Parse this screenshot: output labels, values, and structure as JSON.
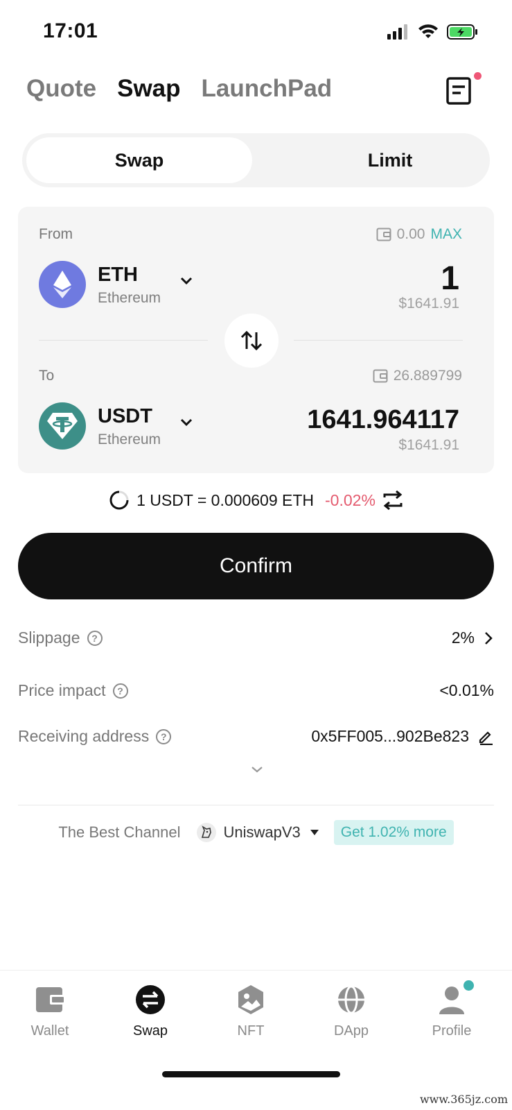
{
  "status_bar": {
    "time": "17:01"
  },
  "top_tabs": [
    {
      "label": "Quote",
      "active": false
    },
    {
      "label": "Swap",
      "active": true
    },
    {
      "label": "LaunchPad",
      "active": false
    }
  ],
  "segment": {
    "swap_label": "Swap",
    "limit_label": "Limit",
    "active": "Swap"
  },
  "from": {
    "label": "From",
    "balance": "0.00",
    "max_label": "MAX",
    "token_symbol": "ETH",
    "token_chain": "Ethereum",
    "amount": "1",
    "usd_value": "$1641.91"
  },
  "to": {
    "label": "To",
    "balance": "26.889799",
    "token_symbol": "USDT",
    "token_chain": "Ethereum",
    "amount": "1641.964117",
    "usd_value": "$1641.91"
  },
  "rate": {
    "text": "1 USDT = 0.000609 ETH",
    "change": "-0.02%"
  },
  "confirm_label": "Confirm",
  "details": {
    "slippage_label": "Slippage",
    "slippage_value": "2%",
    "price_impact_label": "Price impact",
    "price_impact_value": "<0.01%",
    "receiving_address_label": "Receiving address",
    "receiving_address_value": "0x5FF005...902Be823"
  },
  "channel": {
    "label": "The Best Channel",
    "dex": "UniswapV3",
    "promo": "Get 1.02% more"
  },
  "bottom_nav": [
    {
      "label": "Wallet",
      "icon": "wallet-icon",
      "active": false
    },
    {
      "label": "Swap",
      "icon": "swap-icon",
      "active": true
    },
    {
      "label": "NFT",
      "icon": "nft-icon",
      "active": false
    },
    {
      "label": "DApp",
      "icon": "globe-icon",
      "active": false
    },
    {
      "label": "Profile",
      "icon": "profile-icon",
      "active": false
    }
  ],
  "watermark": "www.365jz.com",
  "colors": {
    "accent": "#3fb3b0",
    "negative": "#e45a6e",
    "primary_button": "#111111"
  }
}
